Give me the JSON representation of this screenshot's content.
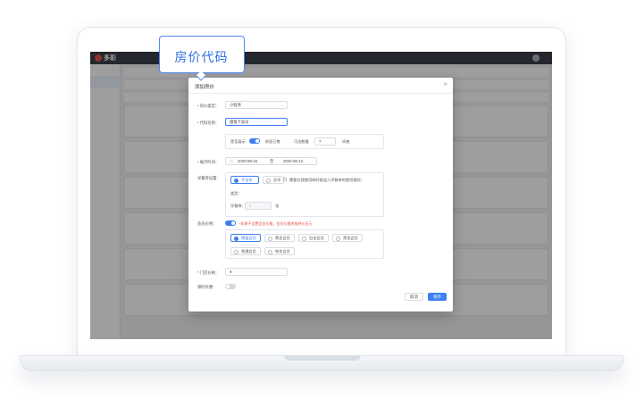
{
  "callout": {
    "label": "房价代码"
  },
  "app": {
    "logo_text": "多彩"
  },
  "modal": {
    "title": "添加房价",
    "rate_type": {
      "label": "房价类型：",
      "value": "小程序"
    },
    "code_name": {
      "label": "代码名称：",
      "value": "储值卡会员"
    },
    "display": {
      "show_label": "是否展示",
      "label2": "前段已售",
      "label3": "可选数量",
      "quantity": "7",
      "unit": "间夜"
    },
    "validity": {
      "label": "展示时间：",
      "start": "2020-08-15",
      "sep": "至",
      "end": "2020-08-13"
    },
    "cancel_policy": {
      "label": "早餐券设置：",
      "options": [
        "不含早",
        "含早"
      ],
      "checkbox_text": "需要在我使用的时候加入早餐券的使用规则；",
      "sub_label": "类型：",
      "input_label": "早餐券：",
      "input_placeholder": "0",
      "input_unit": "张"
    },
    "member": {
      "label": "会员价格：",
      "warning": "*如果不设置会员价格，会员价格将按原价显示",
      "options": [
        "储值会员",
        "黄金会员",
        "白金会员",
        "黑金会员",
        "普通会员",
        "铂金会员"
      ]
    },
    "price": {
      "label": "* 门店价格：",
      "prefix": "¥"
    },
    "limit": {
      "label": "限时优惠："
    },
    "cancel_btn": "取消",
    "confirm_btn": "保存"
  }
}
